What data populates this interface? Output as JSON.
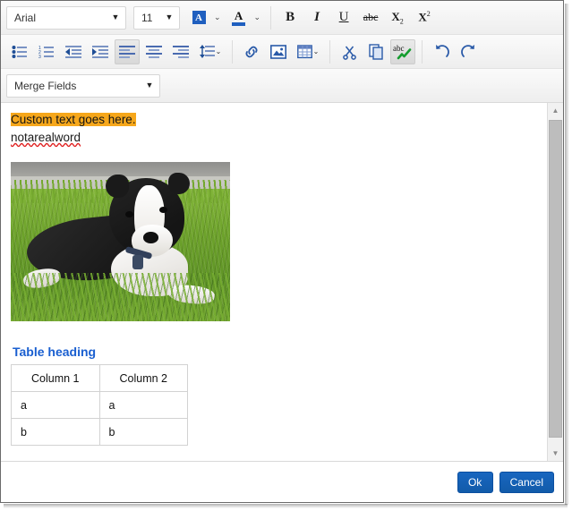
{
  "toolbar": {
    "font_family": {
      "value": "Arial",
      "caret": "▼"
    },
    "font_size": {
      "value": "11",
      "caret": "▼"
    },
    "merge_fields": {
      "value": "Merge Fields",
      "caret": "▼"
    },
    "highlight_color": {
      "glyph": "A",
      "caret": "⌄",
      "swatch": "#1f5fbf"
    },
    "font_color": {
      "glyph": "A",
      "caret": "⌄",
      "swatch": "#1f5fbf"
    },
    "bold": "B",
    "italic": "I",
    "underline": "U",
    "strikethrough": "abc",
    "subscript": "X",
    "subscript_mark": "2",
    "superscript": "X",
    "superscript_mark": "2",
    "line_spacing_caret": "⌄",
    "table_caret": "⌄"
  },
  "content": {
    "highlighted_text": "Custom text goes here.",
    "misspelled_text": "notarealword",
    "table_heading": "Table heading",
    "table": {
      "headers": [
        "Column 1",
        "Column 2"
      ],
      "rows": [
        [
          "a",
          "a"
        ],
        [
          "b",
          "b"
        ]
      ]
    }
  },
  "scrollbar": {
    "up": "▲",
    "down": "▼"
  },
  "footer": {
    "ok_label": "Ok",
    "cancel_label": "Cancel"
  },
  "colors": {
    "highlight": "#f6a71b",
    "spell_underline": "#e02020",
    "heading_blue": "#1a5fd0",
    "button_blue": "#1866c0",
    "icon_blue": "#1f4e96"
  }
}
